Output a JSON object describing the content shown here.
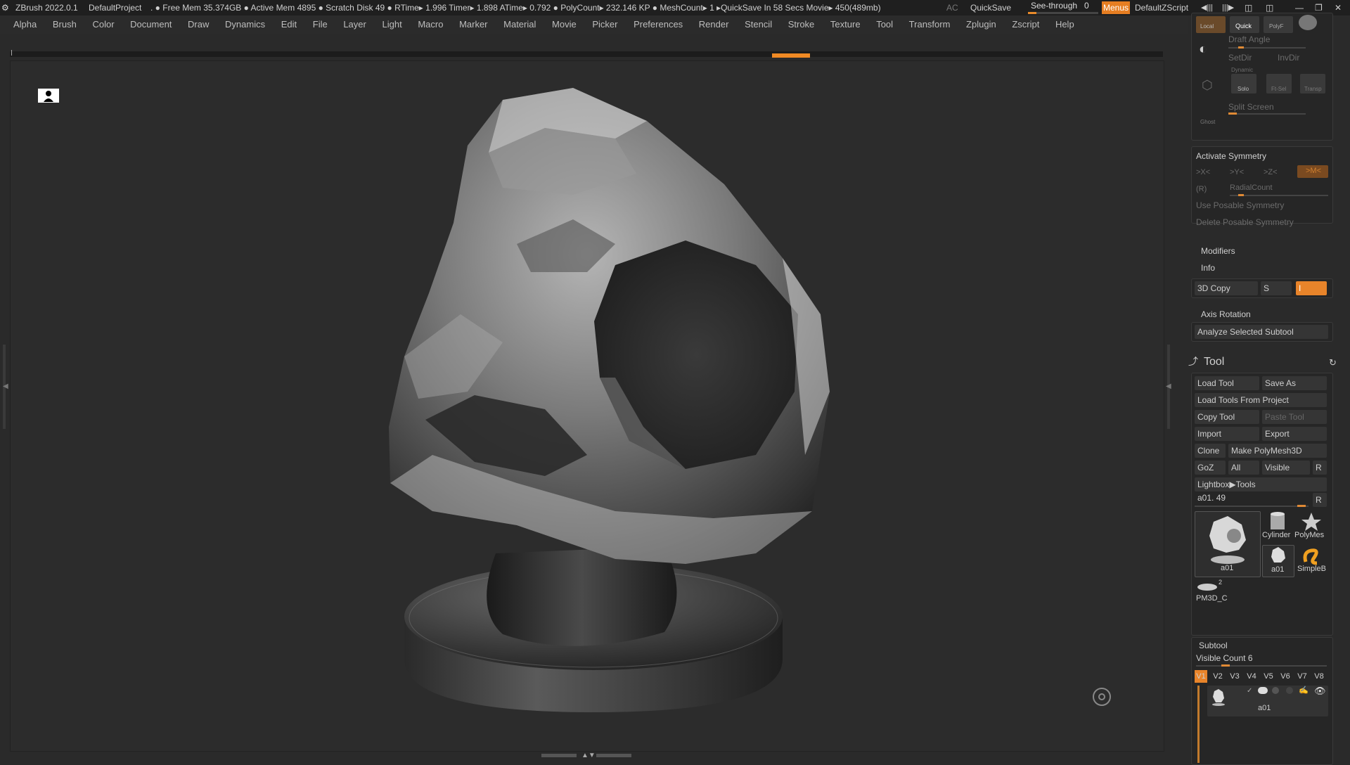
{
  "titlebar": {
    "app": "ZBrush 2022.0.1",
    "project": "DefaultProject",
    "stats": ". ● Free Mem 35.374GB ● Active Mem 4895 ● Scratch Disk 49 ●  RTime▸ 1.996 Timer▸ 1.898 ATime▸ 0.792 ● PolyCount▸ 232.146 KP  ● MeshCount▸ 1  ▸QuickSave In 58 Secs Movie▸ 450(489mb)",
    "ac": "AC",
    "quicksave": "QuickSave",
    "see_through_label": "See-through",
    "see_through_value": "0",
    "see_through_level": 0.12,
    "menus": "Menus",
    "script": "DefaultZScript"
  },
  "menubar": [
    "Alpha",
    "Brush",
    "Color",
    "Document",
    "Draw",
    "Dynamics",
    "Edit",
    "File",
    "Layer",
    "Light",
    "Macro",
    "Marker",
    "Material",
    "Movie",
    "Picker",
    "Preferences",
    "Render",
    "Stencil",
    "Stroke",
    "Texture",
    "Tool",
    "Transform",
    "Zplugin",
    "Zscript",
    "Help"
  ],
  "toppanel": {
    "local": "Local",
    "quick": "Quick",
    "polyf": "PolyF",
    "draft_angle": "Draft Angle",
    "setdir": "SetDir",
    "invdir": "InvDir",
    "dynamic": "Dynamic",
    "solo": "Solo",
    "ftsel": "Ft-Sel",
    "transp": "Transp",
    "split_screen": "Split Screen",
    "ghost": "Ghost"
  },
  "symmetry": {
    "title": "Activate Symmetry",
    "x": ">X<",
    "y": ">Y<",
    "z": ">Z<",
    "m": ">M<",
    "r": "(R)",
    "radial": "RadialCount",
    "posable": "Use Posable Symmetry",
    "delete_posable": "Delete Posable Symmetry"
  },
  "modifiers": "Modifiers",
  "info": "Info",
  "copy3d": {
    "label": "3D Copy",
    "s": "S",
    "value": "I"
  },
  "axis_rotation": "Axis Rotation",
  "analyze": "Analyze Selected Subtool",
  "tool": {
    "title": "Tool",
    "load_tool": "Load Tool",
    "save_as": "Save As",
    "load_from_project": "Load Tools From Project",
    "copy_tool": "Copy Tool",
    "paste_tool": "Paste Tool",
    "import": "Import",
    "export": "Export",
    "clone": "Clone",
    "make_polymesh": "Make PolyMesh3D",
    "goz": "GoZ",
    "all": "All",
    "visible": "Visible",
    "r": "R",
    "lightbox": "Lightbox▶Tools",
    "current": "a01. 49",
    "thumbs": [
      "a01",
      "Cylinder",
      "PolyMes",
      "a01",
      "SimpleB",
      "PM3D_C"
    ],
    "pm3d_badge": "2"
  },
  "subtool": {
    "title": "Subtool",
    "visible_count": "Visible Count 6",
    "tabs": [
      "V1",
      "V2",
      "V3",
      "V4",
      "V5",
      "V6",
      "V7",
      "V8"
    ],
    "item": "a01"
  }
}
